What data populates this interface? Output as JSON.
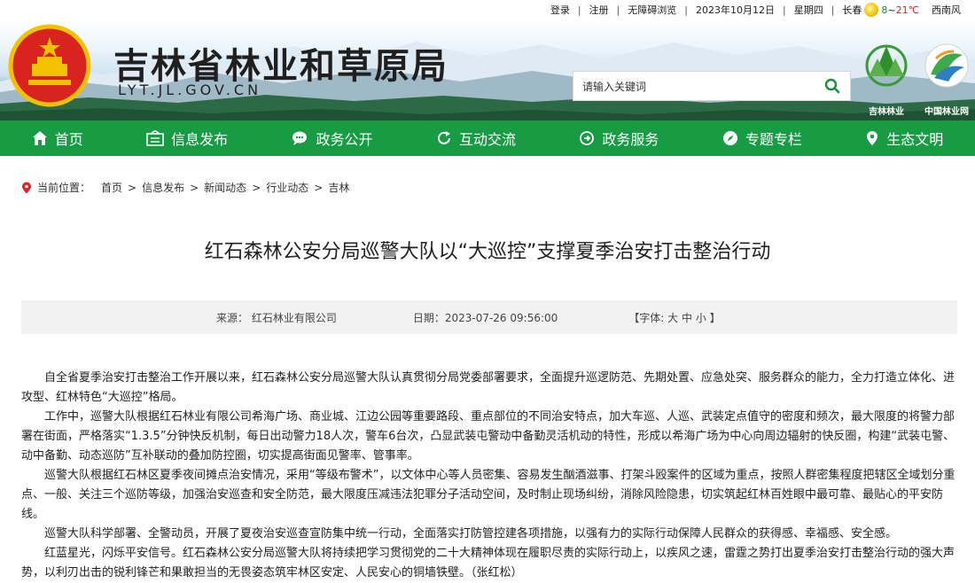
{
  "topbar": {
    "login": "登录",
    "register": "注册",
    "accessible": "无障碍浏览",
    "date": "2023年10月12日",
    "weekday": "星期四",
    "city": "长春",
    "temp_low": "8",
    "temp_sep": "~",
    "temp_high": "21℃",
    "wind": "西南风",
    "icons": [
      "sun-icon"
    ]
  },
  "header": {
    "title": "吉林省林业和草原局",
    "domain": "LYT.JL.GOV.CN",
    "search_placeholder": "请输入关键词",
    "logo_left_caption": "吉林林业",
    "logo_right_caption": "中国林业网"
  },
  "nav": {
    "items": [
      {
        "label": "首页",
        "icon": "home-icon"
      },
      {
        "label": "信息发布",
        "icon": "info-icon"
      },
      {
        "label": "政务公开",
        "icon": "chat-icon"
      },
      {
        "label": "互动交流",
        "icon": "refresh-icon"
      },
      {
        "label": "政务服务",
        "icon": "service-icon"
      },
      {
        "label": "专题专栏",
        "icon": "compass-icon"
      },
      {
        "label": "生态文明",
        "icon": "location-icon"
      }
    ]
  },
  "breadcrumb": {
    "label": "当前位置：",
    "items": [
      "首页",
      "信息发布",
      "新闻动态",
      "行业动态",
      "吉林"
    ],
    "separator": ">"
  },
  "article": {
    "title": "红石森林公安分局巡警大队以“大巡控”支撑夏季治安打击整治行动",
    "source": "来源：  红石林业有限公司",
    "date": "日期：2023-07-26 09:56:00",
    "font_prefix": "【字体:",
    "font_large": "大",
    "font_medium": "中",
    "font_small": "小",
    "font_suffix": "】",
    "paragraphs": [
      "自全省夏季治安打击整治工作开展以来，红石森林公安分局巡警大队认真贯彻分局党委部署要求，全面提升巡逻防范、先期处置、应急处突、服务群众的能力，全力打造立体化、进攻型、红林特色“大巡控”格局。",
      "工作中，巡警大队根据红石林业有限公司希海广场、商业城、江边公园等重要路段、重点部位的不同治安特点，加大车巡、人巡、武装定点值守的密度和频次，最大限度的将警力部署在街面，严格落实“1.3.5”分钟快反机制，每日出动警力18人次，警车6台次，凸显武装屯警动中备勤灵活机动的特性，形成以希海广场为中心向周边辐射的快反圈，构建“武装屯警、动中备勤、动态巡防”互补联动的叠加防控圈，切实提高街面见警率、管事率。",
      "巡警大队根据红石林区夏季夜间摊点治安情况，采用“等级布警术”，以文体中心等人员密集、容易发生酗酒滋事、打架斗殴案件的区域为重点，按照人群密集程度把辖区全域划分重点、一般、关注三个巡防等级，加强治安巡查和安全防范，最大限度压减违法犯罪分子活动空间，及时制止现场纠纷，消除风险隐患，切实筑起红林百姓眼中最可靠、最贴心的平安防线。",
      "巡警大队科学部署、全警动员，开展了夏夜治安巡查宣防集中统一行动，全面落实打防管控建各项措施，以强有力的实际行动保障人民群众的获得感、幸福感、安全感。",
      "红蓝星光，闪烁平安信号。红石森林公安分局巡警大队将持续把学习贯彻党的二十大精神体现在履职尽责的实际行动上，以疾风之速，雷霆之势打出夏季治安打击整治行动的强大声势，以利刃出击的锐利锋芒和果敢担当的无畏姿态筑牢林区安定、人民安心的铜墙铁壁。（张红松）"
    ]
  },
  "colors": {
    "nav_green": "#179c43",
    "accent_red": "#e02020",
    "meta_bg": "#f2f2f2"
  }
}
